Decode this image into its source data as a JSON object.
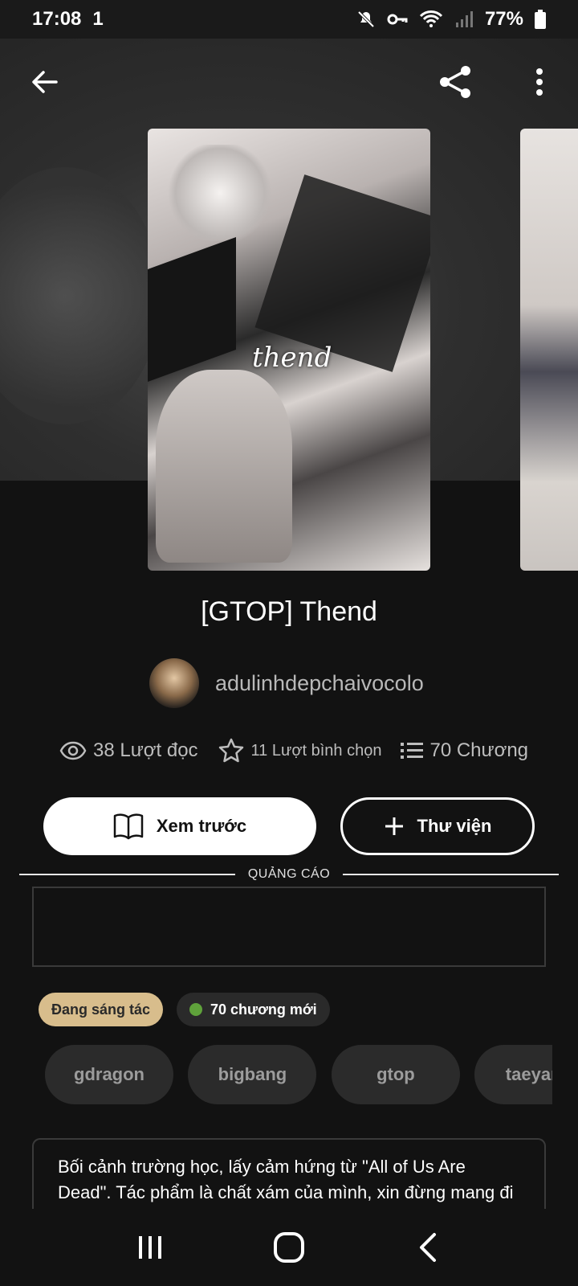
{
  "status_bar": {
    "time": "17:08",
    "sim_indicator": "1",
    "battery": "77%",
    "icons": [
      "mute-icon",
      "vpn-key-icon",
      "wifi-icon",
      "signal-icon",
      "battery-icon"
    ]
  },
  "header": {
    "back_icon": "back-arrow-icon",
    "share_icon": "share-icon",
    "more_icon": "more-vertical-icon"
  },
  "cover": {
    "script_text": "thend"
  },
  "story": {
    "title": "[GTOP] Thend",
    "author": "adulinhdepchaivocolo"
  },
  "stats": {
    "reads": "38 Lượt đọc",
    "votes": "11 Lượt bình chọn",
    "chapters": "70 Chương"
  },
  "actions": {
    "preview_label": "Xem trước",
    "library_label": "Thư viện"
  },
  "ad": {
    "label": "QUẢNG CÁO"
  },
  "badges": {
    "status": "Đang sáng tác",
    "new_chapters": "70 chương mới",
    "new_dot_color": "#5fa23b",
    "status_color": "#d8bd8c"
  },
  "tags": [
    "gdragon",
    "bigbang",
    "gtop",
    "taeyang"
  ],
  "description": {
    "text": "Bối cảnh trường học, lấy cảm hứng từ \"All of Us Are Dead\". Tác phẩm là chất xám của mình, xin đừng mang đi nơi khác..."
  },
  "nav": {
    "icons": [
      "recent-apps-icon",
      "home-icon",
      "back-icon"
    ]
  }
}
